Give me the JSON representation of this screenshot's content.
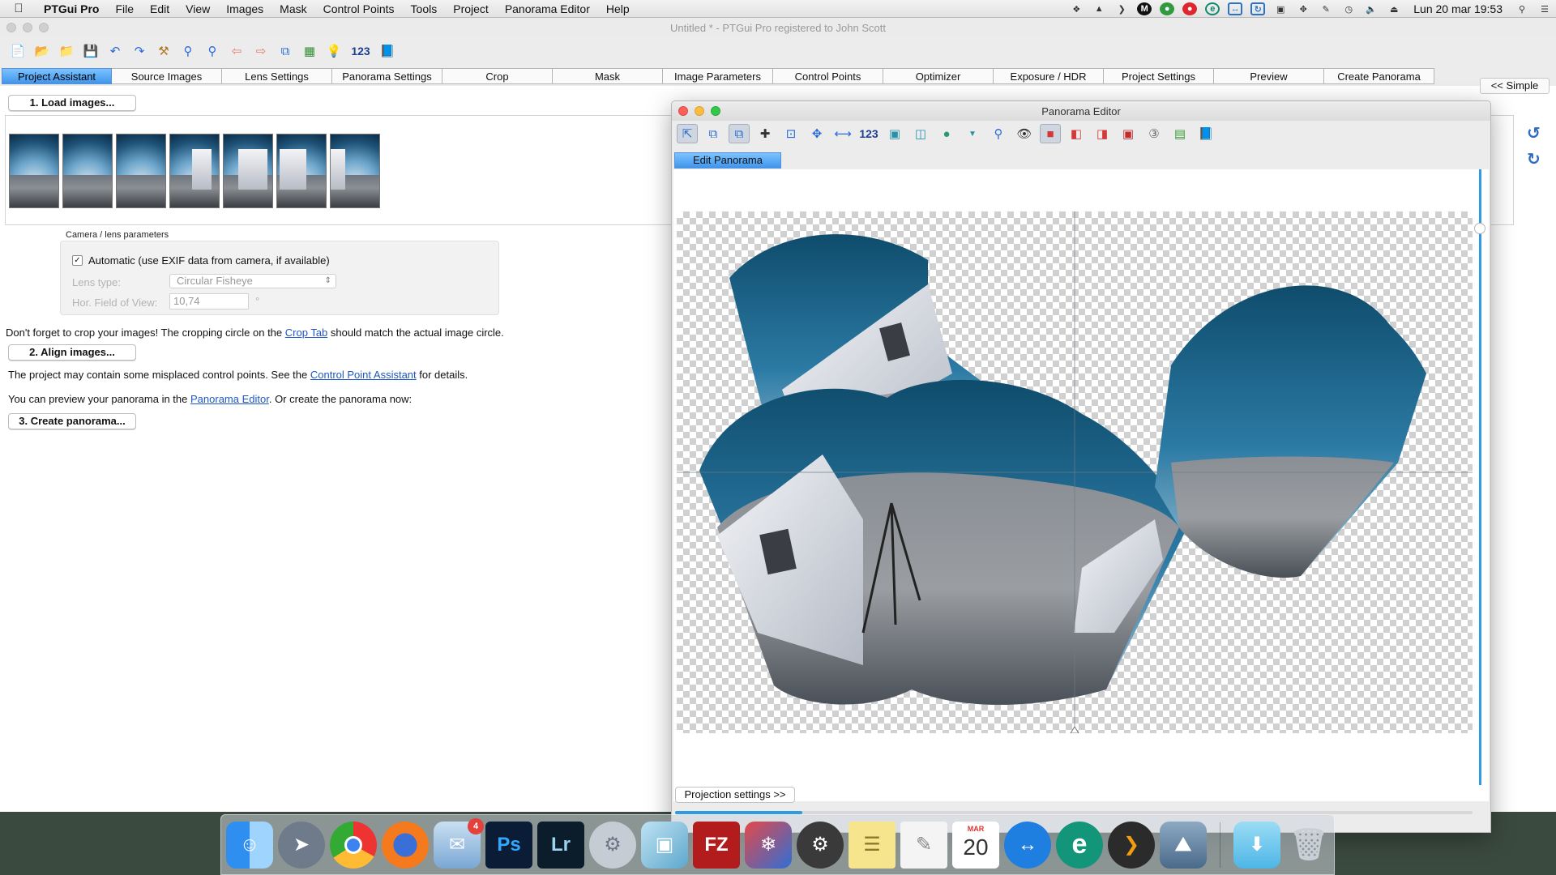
{
  "menubar": {
    "app_name": "PTGui Pro",
    "items": [
      "File",
      "Edit",
      "View",
      "Images",
      "Mask",
      "Control Points",
      "Tools",
      "Project",
      "Panorama Editor",
      "Help"
    ],
    "clock": "Lun 20 mar  19:53"
  },
  "window": {
    "title": "Untitled * - PTGui Pro registered to John Scott"
  },
  "toolbar": {
    "numbers_label": "123"
  },
  "tabs": [
    "Project Assistant",
    "Source Images",
    "Lens Settings",
    "Panorama Settings",
    "Crop",
    "Mask",
    "Image Parameters",
    "Control Points",
    "Optimizer",
    "Exposure / HDR",
    "Project Settings",
    "Preview",
    "Create Panorama"
  ],
  "assistant": {
    "load_button": "1. Load images...",
    "camera_group_label": "Camera / lens parameters",
    "automatic_label": "Automatic (use EXIF data from camera, if available)",
    "automatic_checked": true,
    "lens_type_label": "Lens type:",
    "lens_type_value": "Circular Fisheye",
    "fov_label": "Hor. Field of View:",
    "fov_value": "10,74",
    "fov_unit": "°",
    "crop_text_before": "Don't forget to crop your images! The cropping circle on the ",
    "crop_link": "Crop Tab",
    "crop_text_after": " should match the actual image circle.",
    "align_button": "2. Align images...",
    "cp_text_before": "The project may contain some misplaced control points. See the ",
    "cp_link": "Control Point Assistant",
    "cp_text_after": " for details.",
    "preview_text_before": "You can preview your panorama in the ",
    "preview_link": "Panorama Editor",
    "preview_text_after": ". Or create the panorama now:",
    "create_button": "3. Create panorama...",
    "simple_button": "<< Simple"
  },
  "pano_editor": {
    "title": "Panorama Editor",
    "numbers_label": "123",
    "tab": "Edit Panorama",
    "projection_button": "Projection settings >>",
    "slider_level": 0.16
  },
  "dock": {
    "mail_badge": "4",
    "calendar_month": "MAR",
    "calendar_day": "20",
    "photoshop_label": "Ps",
    "lightroom_label": "Lr",
    "filezilla_label": "FZ",
    "evernote_label": "e"
  }
}
